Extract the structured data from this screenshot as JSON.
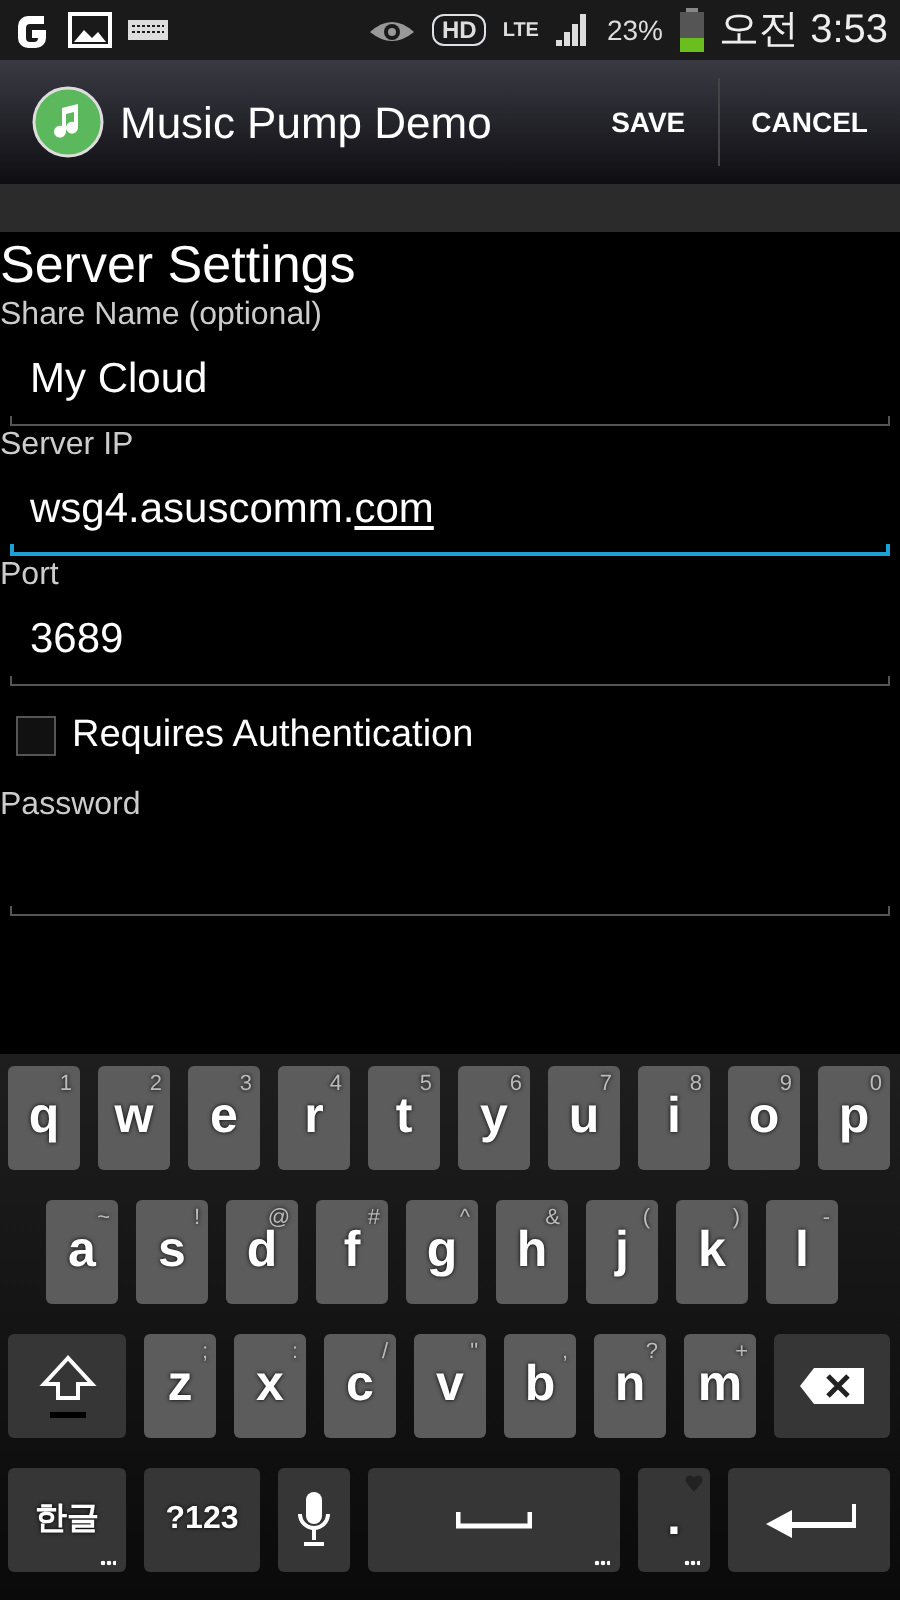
{
  "status_bar": {
    "hd": "HD",
    "network": "LTE",
    "battery": "23%",
    "time": "오전 3:53"
  },
  "action_bar": {
    "title": "Music Pump Demo",
    "actions": [
      "SAVE",
      "CANCEL"
    ]
  },
  "heading": "Server Settings",
  "fields": [
    {
      "kind": "text",
      "label": "Share Name (optional)",
      "value": "My Cloud",
      "focused": false
    },
    {
      "kind": "text",
      "label": "Server IP",
      "value": "wsg4.asuscomm.",
      "composing": "com",
      "focused": true
    },
    {
      "kind": "text",
      "label": "Port",
      "value": "3689",
      "focused": false
    },
    {
      "kind": "checkbox",
      "label": "Requires Authentication",
      "checked": false
    },
    {
      "kind": "text",
      "label": "Password",
      "focused": false
    }
  ],
  "keyboard": [
    [
      {
        "kind": "letter",
        "label": "q",
        "hint": "1"
      },
      {
        "kind": "letter",
        "label": "w",
        "hint": "2"
      },
      {
        "kind": "letter",
        "label": "e",
        "hint": "3"
      },
      {
        "kind": "letter",
        "label": "r",
        "hint": "4"
      },
      {
        "kind": "letter",
        "label": "t",
        "hint": "5"
      },
      {
        "kind": "letter",
        "label": "y",
        "hint": "6"
      },
      {
        "kind": "letter",
        "label": "u",
        "hint": "7"
      },
      {
        "kind": "letter",
        "label": "i",
        "hint": "8"
      },
      {
        "kind": "letter",
        "label": "o",
        "hint": "9"
      },
      {
        "kind": "letter",
        "label": "p",
        "hint": "0"
      }
    ],
    [
      {
        "kind": "letter",
        "label": "a",
        "hint": "~"
      },
      {
        "kind": "letter",
        "label": "s",
        "hint": "!"
      },
      {
        "kind": "letter",
        "label": "d",
        "hint": "@"
      },
      {
        "kind": "letter",
        "label": "f",
        "hint": "#"
      },
      {
        "kind": "letter",
        "label": "g",
        "hint": "^"
      },
      {
        "kind": "letter",
        "label": "h",
        "hint": "&"
      },
      {
        "kind": "letter",
        "label": "j",
        "hint": "("
      },
      {
        "kind": "letter",
        "label": "k",
        "hint": ")"
      },
      {
        "kind": "letter",
        "label": "l",
        "hint": "-"
      }
    ],
    [
      {
        "kind": "shift"
      },
      {
        "kind": "letter",
        "label": "z",
        "hint": ";"
      },
      {
        "kind": "letter",
        "label": "x",
        "hint": ":"
      },
      {
        "kind": "letter",
        "label": "c",
        "hint": "/"
      },
      {
        "kind": "letter",
        "label": "v",
        "hint": "\""
      },
      {
        "kind": "letter",
        "label": "b",
        "hint": ","
      },
      {
        "kind": "letter",
        "label": "n",
        "hint": "?"
      },
      {
        "kind": "letter",
        "label": "m",
        "hint": "+"
      },
      {
        "kind": "backspace"
      }
    ],
    [
      {
        "kind": "text",
        "label": "한글",
        "more": true
      },
      {
        "kind": "text",
        "label": "?123",
        "more": false
      },
      {
        "kind": "mic"
      },
      {
        "kind": "space",
        "more": true
      },
      {
        "kind": "period",
        "label": ".",
        "more": true
      },
      {
        "kind": "enter"
      }
    ]
  ]
}
